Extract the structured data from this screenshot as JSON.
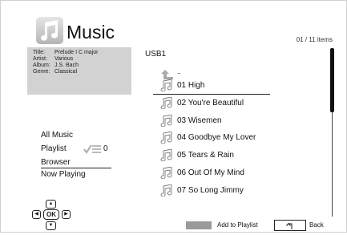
{
  "header": {
    "title": "Music",
    "icon": "music-note-icon",
    "item_count": "01 / 11 items"
  },
  "info": {
    "title_label": "Title:",
    "title_value": "Prelude I C major",
    "artist_label": "Artist:",
    "artist_value": "Various",
    "album_label": "Album:",
    "album_value": "J.S. Bach",
    "genre_label": "Genre:",
    "genre_value": "Classical"
  },
  "menu": {
    "items": [
      {
        "label": "All Music"
      },
      {
        "label": "Playlist"
      },
      {
        "label": "Browser"
      },
      {
        "label": "Now Playing"
      }
    ],
    "playlist_count": "0"
  },
  "dpad": {
    "ok": "OK"
  },
  "browser": {
    "source": "USB1",
    "up_label": "..",
    "tracks": [
      {
        "name": "01 High"
      },
      {
        "name": "02 You're Beautiful"
      },
      {
        "name": "03 Wisemen"
      },
      {
        "name": "04 Goodbye My Lover"
      },
      {
        "name": "05 Tears & Rain"
      },
      {
        "name": "06 Out Of My Mind"
      },
      {
        "name": "07 So Long Jimmy"
      }
    ]
  },
  "footer": {
    "add_label": "Add to Playlist",
    "back_label": "Back"
  },
  "colors": {
    "info_panel": "#d2d2d2",
    "gray_key": "#9a9a9a"
  }
}
